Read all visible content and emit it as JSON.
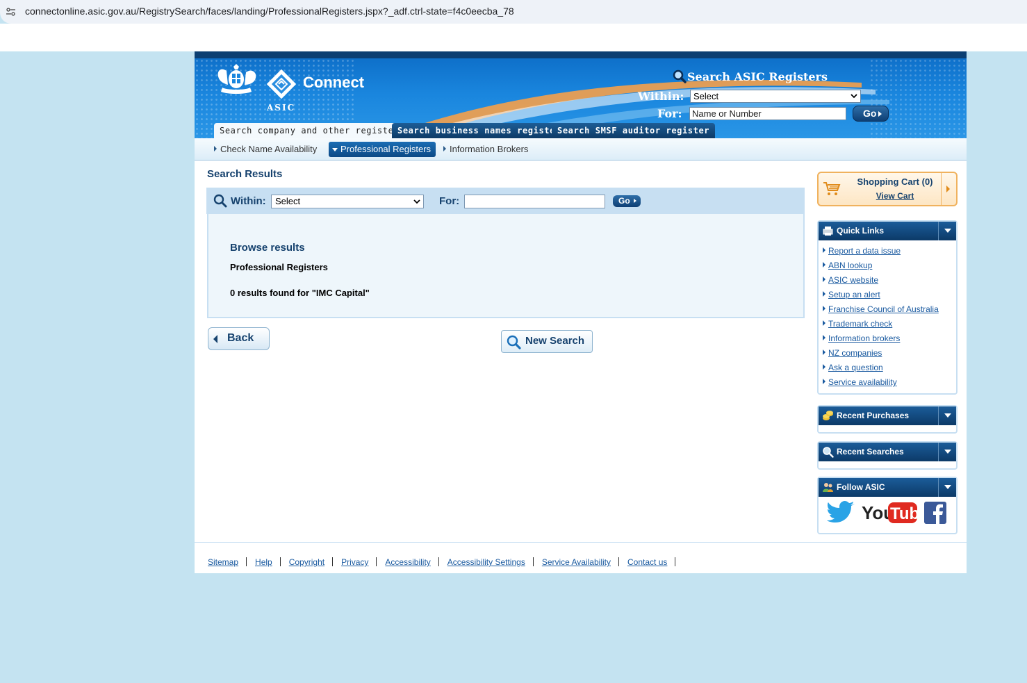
{
  "browser": {
    "url": "connectonline.asic.gov.au/RegistrySearch/faces/landing/ProfessionalRegisters.jspx?_adf.ctrl-state=f4c0eecba_78"
  },
  "header": {
    "brand": "Connect",
    "logo_text": "ASIC",
    "search_title": "Search ASIC Registers",
    "within_label": "Within:",
    "within_value": "Select",
    "for_label": "For:",
    "for_placeholder": "Name or Number",
    "go_label": "Go"
  },
  "tabs": [
    {
      "label": "Search company and other registers",
      "active": true
    },
    {
      "label": "Search business names register",
      "active": false
    },
    {
      "label": "Search SMSF auditor register",
      "active": false
    }
  ],
  "subnav": [
    {
      "label": "Check Name Availability",
      "active": false
    },
    {
      "label": "Professional Registers",
      "active": true
    },
    {
      "label": "Information Brokers",
      "active": false
    }
  ],
  "main": {
    "title": "Search Results",
    "searchbar": {
      "within_label": "Within:",
      "within_value": "Select",
      "for_label": "For:",
      "for_value": "",
      "go_label": "Go"
    },
    "results": {
      "heading": "Browse results",
      "register": "Professional Registers",
      "count_text": "0 results found for \"IMC Capital\""
    },
    "back_label": "Back",
    "new_search_label": "New Search"
  },
  "sidebar": {
    "cart": {
      "title": "Shopping Cart (0)",
      "view_label": "View Cart"
    },
    "quick_links": {
      "title": "Quick Links",
      "items": [
        "Report a data issue",
        "ABN lookup",
        "ASIC website",
        "Setup an alert",
        "Franchise Council of Australia",
        "Trademark check",
        "Information brokers",
        "NZ companies",
        "Ask a question",
        "Service availability"
      ]
    },
    "recent_purchases": {
      "title": "Recent Purchases"
    },
    "recent_searches": {
      "title": "Recent Searches"
    },
    "follow": {
      "title": "Follow ASIC",
      "youtube_you": "You",
      "youtube_tube": "Tube"
    }
  },
  "footer": {
    "links": [
      "Sitemap",
      "Help",
      "Copyright",
      "Privacy",
      "Accessibility",
      "Accessibility Settings",
      "Service Availability",
      "Contact us"
    ]
  },
  "colors": {
    "page_bg": "#c4e3f1",
    "header_blue": "#1a86de",
    "navy": "#16426e",
    "link": "#1a5aa0",
    "cart_border": "#f0b25e"
  }
}
